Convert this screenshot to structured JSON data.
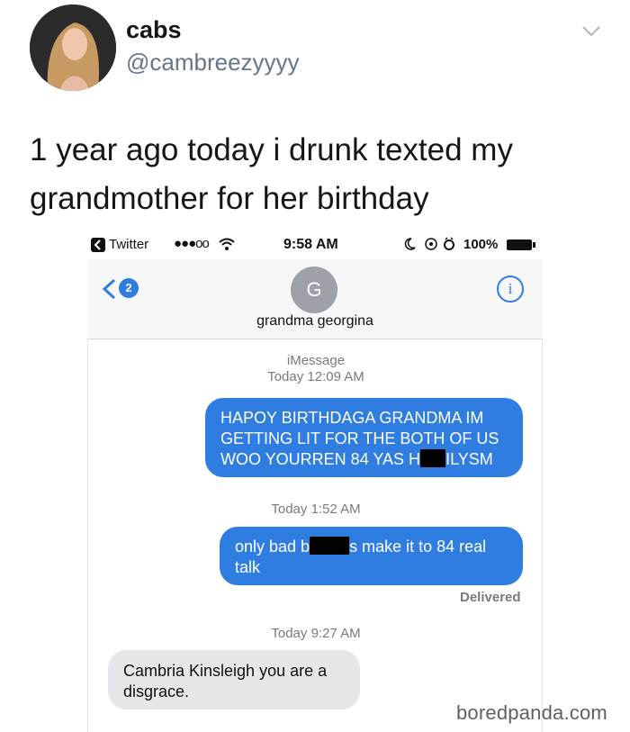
{
  "tweet": {
    "display_name": "cabs",
    "handle": "@cambreezyyyy",
    "text": "1 year ago today i drunk texted my grandmother for her birthday"
  },
  "phone": {
    "status": {
      "back_app": "Twitter",
      "signal": "●●●oo",
      "time": "9:58 AM",
      "battery": "100%"
    },
    "nav": {
      "back_badge": "2",
      "contact_initial": "G",
      "contact_name": "grandma georgina",
      "info": "i"
    },
    "thread": {
      "header_service": "iMessage",
      "header_time": "Today 12:09 AM",
      "msg1_line1": "HAPOY BIRTHDAGA GRANDMA IM",
      "msg1_line2": "GETTING LIT FOR THE BOTH OF US",
      "msg1_line3a": "WOO YOURREN 84 YAS H",
      "msg1_line3b": "ILYSM",
      "ts2": "Today 1:52 AM",
      "msg2_a": "only bad b",
      "msg2_b": "s make it to 84 real",
      "msg2_c": "talk",
      "delivered": "Delivered",
      "ts3": "Today 9:27 AM",
      "msg3_line1": "Cambria Kinsleigh you are a",
      "msg3_line2": "disgrace."
    }
  },
  "watermark": "boredpanda.com",
  "colors": {
    "imessage_blue": "#2f7de1",
    "received_gray": "#e6e6eb",
    "handle_gray": "#657786"
  }
}
